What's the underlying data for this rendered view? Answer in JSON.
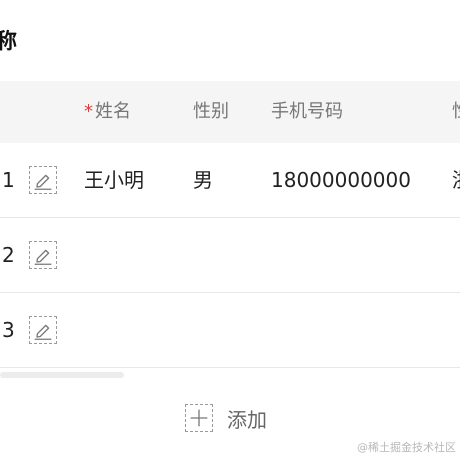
{
  "section": {
    "title": "称"
  },
  "table": {
    "columns": {
      "name_required_mark": "*",
      "name": "姓名",
      "gender": "性别",
      "phone": "手机号码",
      "extra": "性"
    },
    "rows": [
      {
        "index": "1",
        "name": "王小明",
        "gender": "男",
        "phone": "18000000000",
        "extra": "浙"
      },
      {
        "index": "2",
        "name": "",
        "gender": "",
        "phone": "",
        "extra": ""
      },
      {
        "index": "3",
        "name": "",
        "gender": "",
        "phone": "",
        "extra": ""
      }
    ]
  },
  "actions": {
    "add_label": "添加"
  },
  "watermark": "@稀土掘金技术社区",
  "colors": {
    "required": "#e5383b",
    "header_bg": "#f5f5f5",
    "icon_border": "#9a9a9a"
  },
  "icons": {
    "edit": "pencil-edit-icon",
    "add": "plus-icon"
  }
}
